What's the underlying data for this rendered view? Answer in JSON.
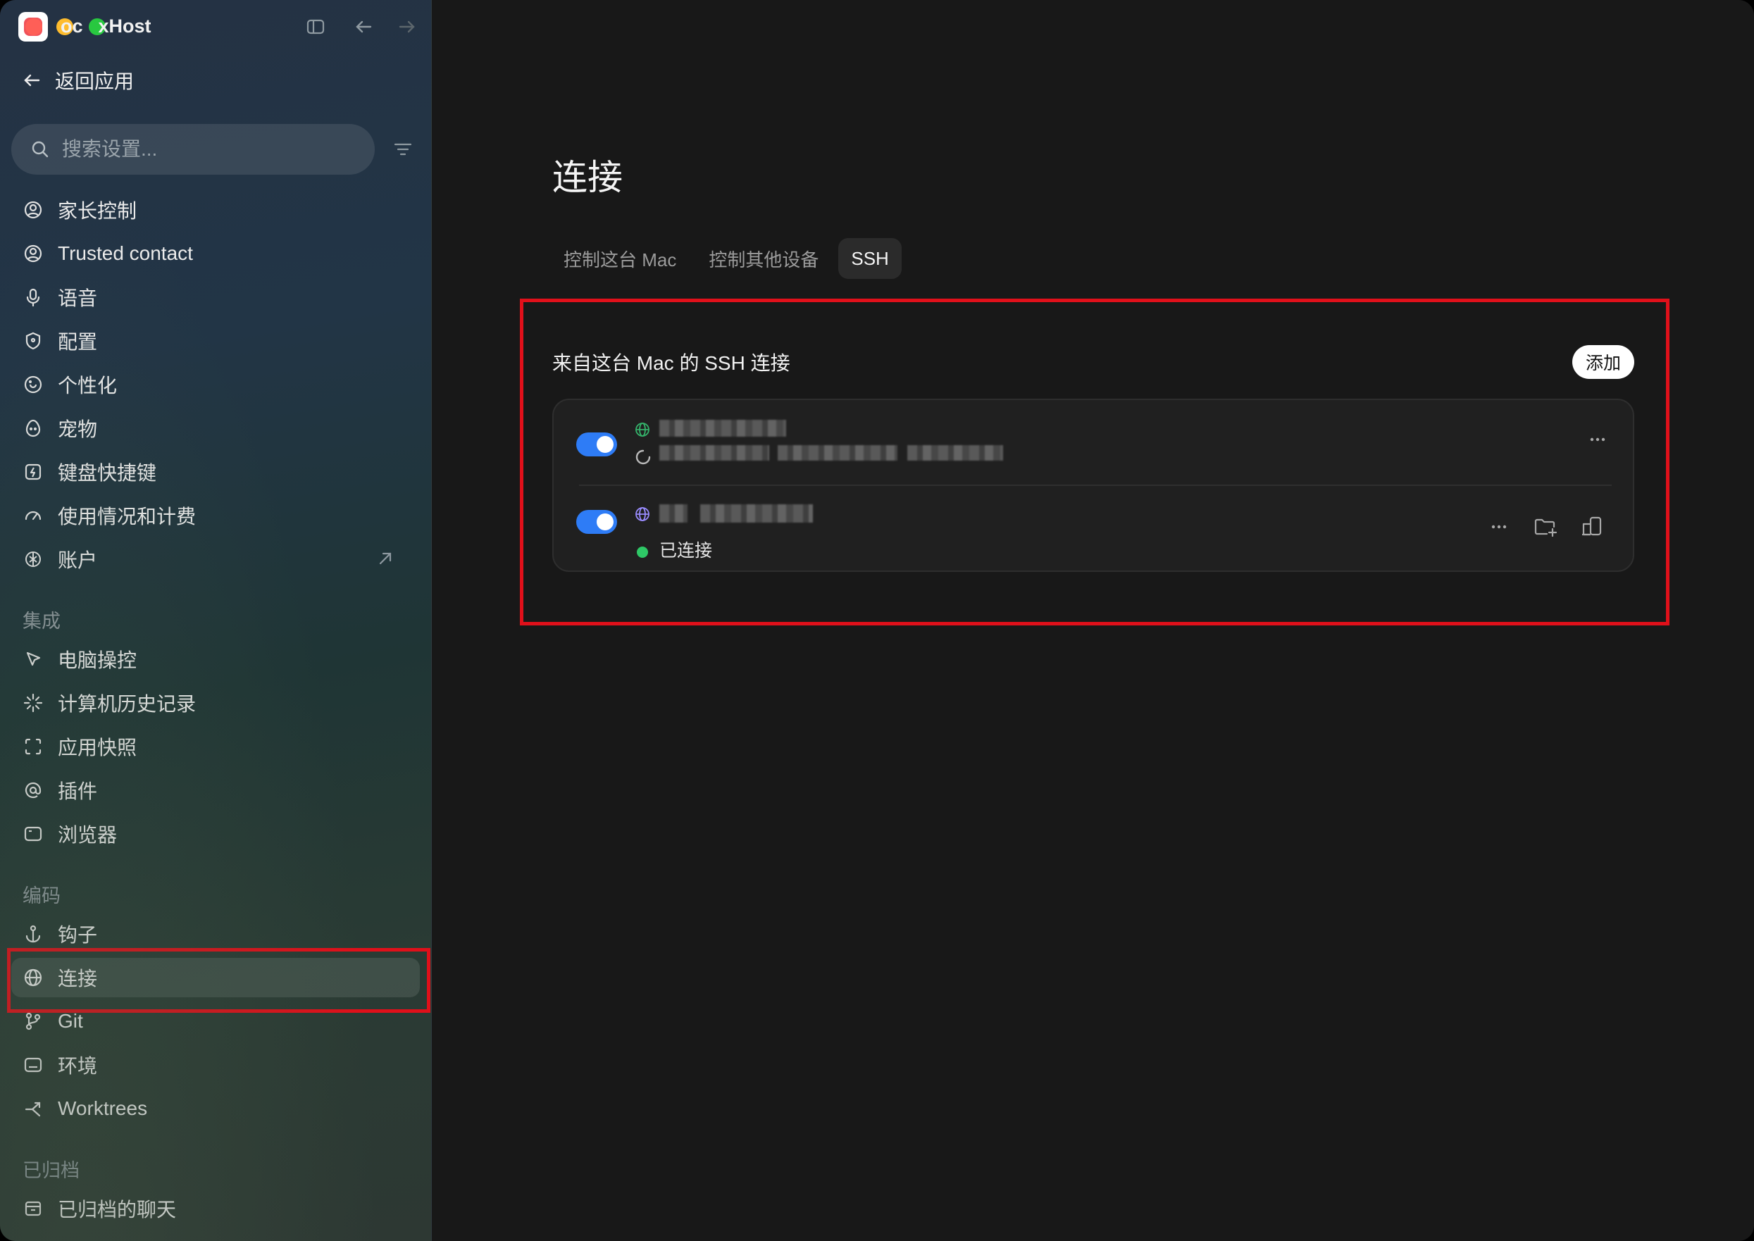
{
  "app": {
    "title": "CodexHost",
    "title_visible_fragment_1": "oc",
    "title_visible_fragment_2": "xHost"
  },
  "sidebar": {
    "back_label": "返回应用",
    "search_placeholder": "搜索设置...",
    "items": [
      {
        "label": "家长控制",
        "icon": "user-circle-icon"
      },
      {
        "label": "Trusted contact",
        "icon": "user-circle-icon"
      },
      {
        "label": "语音",
        "icon": "microphone-icon"
      },
      {
        "label": "配置",
        "icon": "shield-icon"
      },
      {
        "label": "个性化",
        "icon": "palette-icon"
      },
      {
        "label": "宠物",
        "icon": "egg-icon"
      },
      {
        "label": "键盘快捷键",
        "icon": "keyboard-shortcut-icon"
      },
      {
        "label": "使用情况和计费",
        "icon": "gauge-icon"
      },
      {
        "label": "账户",
        "icon": "account-logo-icon"
      }
    ],
    "section_integrations": "集成",
    "integration_items": [
      {
        "label": "电脑操控",
        "icon": "cursor-icon"
      },
      {
        "label": "计算机历史记录",
        "icon": "sparkle-icon"
      },
      {
        "label": "应用快照",
        "icon": "snapshot-icon"
      },
      {
        "label": "插件",
        "icon": "at-icon"
      },
      {
        "label": "浏览器",
        "icon": "browser-icon"
      }
    ],
    "section_coding": "编码",
    "coding_items": [
      {
        "label": "钩子",
        "icon": "anchor-icon"
      },
      {
        "label": "连接",
        "icon": "globe-icon"
      },
      {
        "label": "Git",
        "icon": "git-branch-icon"
      },
      {
        "label": "环境",
        "icon": "terminal-icon"
      },
      {
        "label": "Worktrees",
        "icon": "worktree-icon"
      }
    ],
    "section_archived": "已归档",
    "archived_items": [
      {
        "label": "已归档的聊天",
        "icon": "archive-icon"
      }
    ]
  },
  "main": {
    "title": "连接",
    "tabs": [
      "控制这台 Mac",
      "控制其他设备",
      "SSH"
    ],
    "active_tab": "SSH",
    "section_title": "来自这台 Mac 的 SSH 连接",
    "add_label": "添加",
    "connections": [
      {
        "enabled": true,
        "status": "connecting"
      },
      {
        "enabled": true,
        "status_text": "已连接"
      }
    ]
  },
  "colors": {
    "highlight": "#e0101a",
    "toggle_on": "#2e7cf6",
    "status_connected": "#2ec866"
  }
}
